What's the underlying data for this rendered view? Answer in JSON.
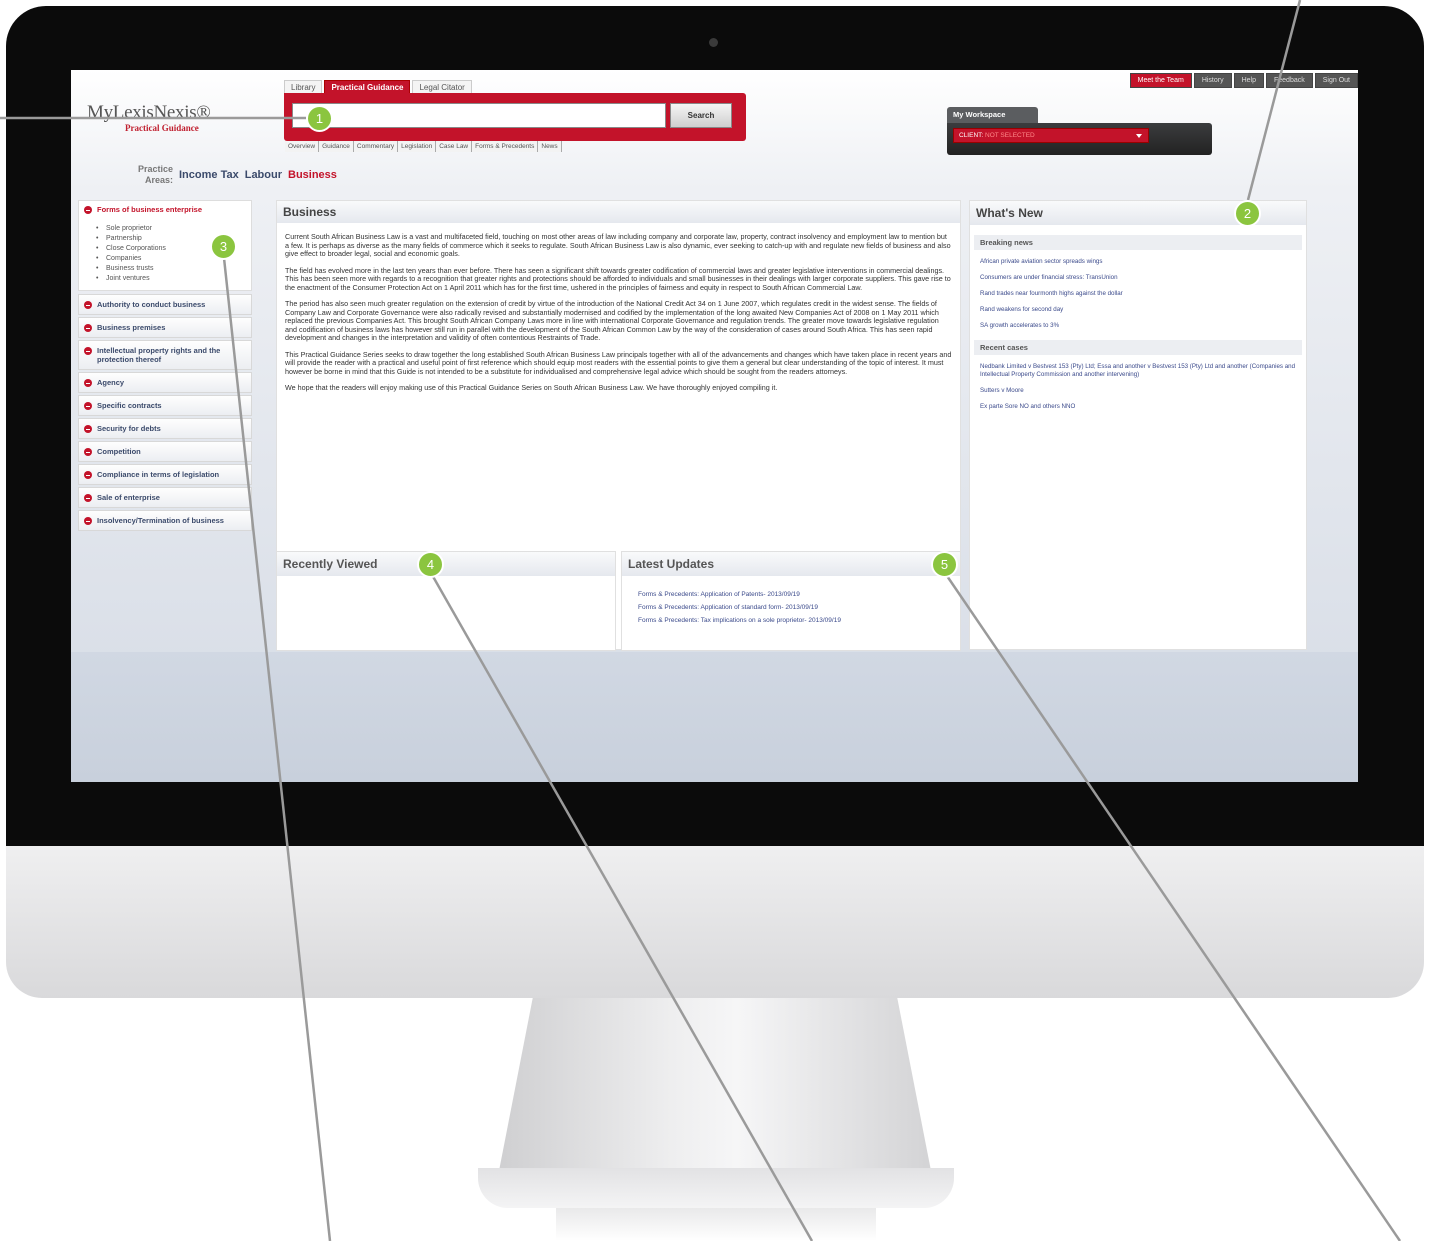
{
  "logo": {
    "main": "MyLexisNexis®",
    "sub": "Practical Guidance"
  },
  "tabs": [
    "Library",
    "Practical Guidance",
    "Legal Citator"
  ],
  "search": {
    "placeholder": "",
    "button": "Search"
  },
  "subnav": [
    "Overview",
    "Guidance",
    "Commentary",
    "Legislation",
    "Case Law",
    "Forms & Precedents",
    "News"
  ],
  "practice": {
    "label": "Practice Areas:",
    "areas": [
      "Income Tax",
      "Labour",
      "Business"
    ]
  },
  "topright": [
    "Meet the Team",
    "History",
    "Help",
    "Feedback",
    "Sign Out"
  ],
  "workspace": {
    "tab": "My Workspace",
    "client_label": "CLIENT:",
    "client_value": "NOT SELECTED"
  },
  "sidebar": {
    "first": {
      "label": "Forms of business enterprise",
      "items": [
        "Sole proprietor",
        "Partnership",
        "Close Corporations",
        "Companies",
        "Business trusts",
        "Joint ventures"
      ]
    },
    "items": [
      "Authority to conduct business",
      "Business premises",
      "Intellectual property rights and the protection thereof",
      "Agency",
      "Specific contracts",
      "Security for debts",
      "Competition",
      "Compliance in terms of legislation",
      "Sale of enterprise",
      "Insolvency/Termination of business"
    ]
  },
  "main": {
    "title": "Business",
    "paragraphs": [
      "Current South African Business Law is a vast and multifaceted field, touching on most other areas of law including company and corporate law, property, contract insolvency and employment law to mention but a few. It is perhaps as diverse as the many fields of commerce which it seeks to regulate. South African Business Law is also dynamic, ever seeking to catch-up with and regulate new fields of business and also give effect to broader legal, social and economic goals.",
      "The field has evolved more in the last ten years than ever before. There has seen a significant shift towards greater codification of commercial laws and greater legislative interventions in commercial dealings. This has been seen more with regards to a recognition that greater rights and protections should be afforded to individuals and small businesses in their dealings with larger corporate suppliers. This gave rise to the enactment of the Consumer Protection Act on 1 April 2011 which has for the first time, ushered in the principles of fairness and equity in respect to South African Commercial Law.",
      "The period has also seen much greater regulation on the extension of credit by virtue of the introduction of the National Credit Act 34 on 1 June 2007, which regulates credit in the widest sense. The fields of Company Law and Corporate Governance were also radically revised and substantially modernised and codified by the implementation of the long awaited New Companies Act of 2008 on 1 May 2011 which replaced the previous Companies Act. This brought South African Company Laws more in line with international Corporate Governance and regulation trends. The greater move towards legislative regulation and codification of business laws has however still run in parallel with the development of the South African Common Law by the way of the consideration of cases around South Africa. This has seen rapid development and changes in the interpretation and validity of often contentious Restraints of Trade.",
      "This Practical Guidance Series seeks to draw together the long established South African Business Law principals together with all of the advancements and changes which have taken place in recent years and will provide the reader with a practical and useful point of first reference which should equip most readers with the essential points to give them a general but clear understanding of the topic of interest. It must however be borne in mind that this Guide is not intended to be a substitute for individualised and comprehensive legal advice which should be sought from the readers attorneys.",
      "We hope that the readers will enjoy making use of this Practical Guidance Series on South African Business Law. We have thoroughly enjoyed compiling it."
    ]
  },
  "recently_viewed": {
    "title": "Recently Viewed"
  },
  "latest_updates": {
    "title": "Latest Updates",
    "items": [
      "Forms & Precedents: Application of Patents- 2013/09/19",
      "Forms & Precedents: Application of standard form- 2013/09/19",
      "Forms & Precedents: Tax implications on a sole proprietor- 2013/09/19"
    ]
  },
  "whats_new": {
    "title": "What's New",
    "breaking_title": "Breaking news",
    "breaking": [
      "African private aviation sector spreads wings",
      "Consumers are under financial stress: TransUnion",
      "Rand trades near fourmonth highs against the dollar",
      "Rand weakens for second day",
      "SA growth accelerates to 3%"
    ],
    "cases_title": "Recent cases",
    "cases": [
      "Nedbank Limited v Bestvest 153 (Pty) Ltd; Essa and another v Bestvest 153 (Pty) Ltd and another (Companies and Intellectual Property Commission and another intervening)",
      "Sutters v Moore",
      "Ex parte Sore NO and others NNO"
    ]
  },
  "callouts": [
    "1",
    "2",
    "3",
    "4",
    "5"
  ],
  "colors": {
    "brand_red": "#c3132a",
    "callout_green": "#8bc53f",
    "link_blue": "#3b4a8b"
  }
}
